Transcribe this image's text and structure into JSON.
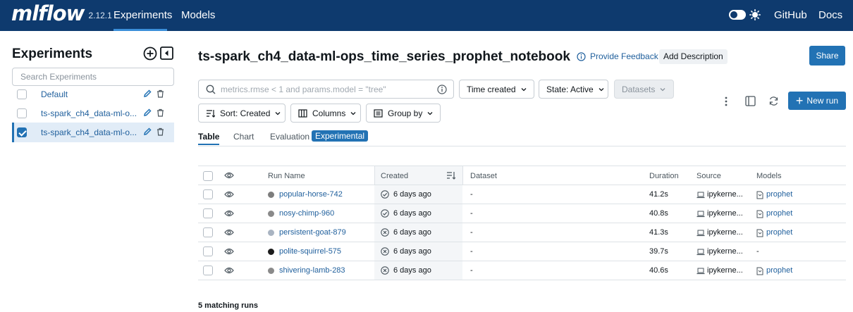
{
  "nav": {
    "logo": "mlflow",
    "version": "2.12.1",
    "experiments": "Experiments",
    "models": "Models",
    "github": "GitHub",
    "docs": "Docs"
  },
  "sidebar": {
    "title": "Experiments",
    "search_placeholder": "Search Experiments",
    "items": [
      {
        "label": "Default",
        "checked": false
      },
      {
        "label": "ts-spark_ch4_data-ml-o...",
        "checked": false
      },
      {
        "label": "ts-spark_ch4_data-ml-o...",
        "checked": true
      }
    ]
  },
  "header": {
    "title": "ts-spark_ch4_data-ml-ops_time_series_prophet_notebook",
    "feedback": "Provide Feedback",
    "add_description": "Add Description",
    "share": "Share"
  },
  "filters": {
    "search_placeholder": "metrics.rmse < 1 and params.model = \"tree\"",
    "time_created": "Time created",
    "state": "State: Active",
    "datasets": "Datasets",
    "sort": "Sort: Created",
    "columns": "Columns",
    "group_by": "Group by",
    "new_run": "New run"
  },
  "tabs": {
    "table": "Table",
    "chart": "Chart",
    "evaluation": "Evaluation",
    "experimental": "Experimental"
  },
  "table": {
    "headers": {
      "run_name": "Run Name",
      "created": "Created",
      "dataset": "Dataset",
      "duration": "Duration",
      "source": "Source",
      "models": "Models"
    },
    "rows": [
      {
        "run_name": "popular-horse-742",
        "color": "#7d7d7d",
        "status": "finished",
        "created": "6 days ago",
        "dataset": "-",
        "duration": "41.2s",
        "source": "ipykerne...",
        "model": "prophet"
      },
      {
        "run_name": "nosy-chimp-960",
        "color": "#8a8a8a",
        "status": "finished",
        "created": "6 days ago",
        "dataset": "-",
        "duration": "40.8s",
        "source": "ipykerne...",
        "model": "prophet"
      },
      {
        "run_name": "persistent-goat-879",
        "color": "#a9b4c2",
        "status": "failed",
        "created": "6 days ago",
        "dataset": "-",
        "duration": "41.3s",
        "source": "ipykerne...",
        "model": "prophet"
      },
      {
        "run_name": "polite-squirrel-575",
        "color": "#1c1c1c",
        "status": "failed",
        "created": "6 days ago",
        "dataset": "-",
        "duration": "39.7s",
        "source": "ipykerne...",
        "model": "-"
      },
      {
        "run_name": "shivering-lamb-283",
        "color": "#8a8a8a",
        "status": "failed",
        "created": "6 days ago",
        "dataset": "-",
        "duration": "40.6s",
        "source": "ipykerne...",
        "model": "prophet"
      }
    ]
  },
  "footer": {
    "matching": "5 matching runs"
  },
  "colors": {
    "nav_bg": "#0e3a6e",
    "primary": "#2272b4",
    "link": "#1f5f9c"
  }
}
